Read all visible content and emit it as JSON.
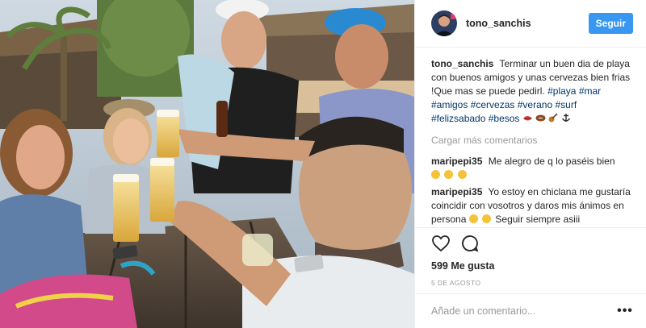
{
  "post": {
    "photo_alt": "",
    "header": {
      "username": "tono_sanchis",
      "follow_label": "Seguir"
    },
    "caption": {
      "author": "tono_sanchis",
      "text": "Terminar un buen dia de playa con buenos amigos y unas cervezas bien frias !Que mas se puede pedirl.",
      "hashtags": [
        "#playa",
        "#mar",
        "#amigos",
        "#cervezas",
        "#verano",
        "#surf",
        "#felizsabado",
        "#besos"
      ],
      "emoji_names": [
        "kiss-mark",
        "rugby-ball",
        "guitar",
        "anchor"
      ]
    },
    "load_more_label": "Cargar más comentarios",
    "comments": [
      {
        "author": "maripepi35",
        "text": "Me alegro de q lo paséis bien",
        "emoji_names": [
          "grinning-face",
          "smiling-face",
          "smiling-face-2"
        ]
      },
      {
        "author": "maripepi35",
        "text_before": "Yo estoy en chiclana me gustaría coincidir con vosotros y daros mis ánimos en persona",
        "emoji_names": [
          "tongue-face",
          "tongue-face-2"
        ],
        "text_after": "Seguir siempre asiii"
      }
    ],
    "likes_label": "599 Me gusta",
    "date_label": "5 de agosto",
    "comment_input_placeholder": "Añade un comentario...",
    "more_options_label": "•••",
    "colors": {
      "follow_button": "#3897f0",
      "hashtag": "#003569",
      "muted_text": "#999999",
      "emoji_yellow": "#f5c33b",
      "emoji_red": "#d63b3b"
    }
  }
}
